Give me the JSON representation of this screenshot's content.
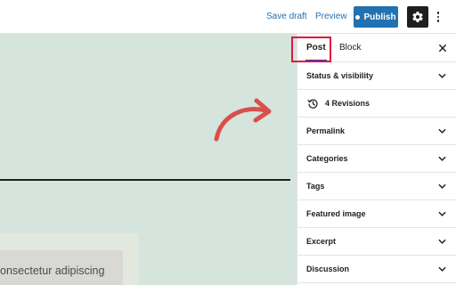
{
  "toolbar": {
    "save_draft": "Save draft",
    "preview": "Preview",
    "publish": "Publish",
    "settings_icon": "gear-icon",
    "more_icon": "more-vertical-icon"
  },
  "canvas": {
    "paragraph_text": "onsectetur adipiscing",
    "background_color": "#d5e4dc",
    "annotation_arrow_color": "#d9504a"
  },
  "sidebar": {
    "tabs": [
      {
        "label": "Post",
        "active": true
      },
      {
        "label": "Block",
        "active": false
      }
    ],
    "close_icon": "close-icon",
    "highlight_color": "#e0153b",
    "panels": [
      {
        "label": "Status & visibility"
      },
      {
        "label": "4 Revisions",
        "icon": "history-icon"
      },
      {
        "label": "Permalink"
      },
      {
        "label": "Categories"
      },
      {
        "label": "Tags"
      },
      {
        "label": "Featured image"
      },
      {
        "label": "Excerpt"
      },
      {
        "label": "Discussion"
      }
    ]
  },
  "colors": {
    "accent": "#2271b1",
    "dark": "#1e1e1e"
  }
}
